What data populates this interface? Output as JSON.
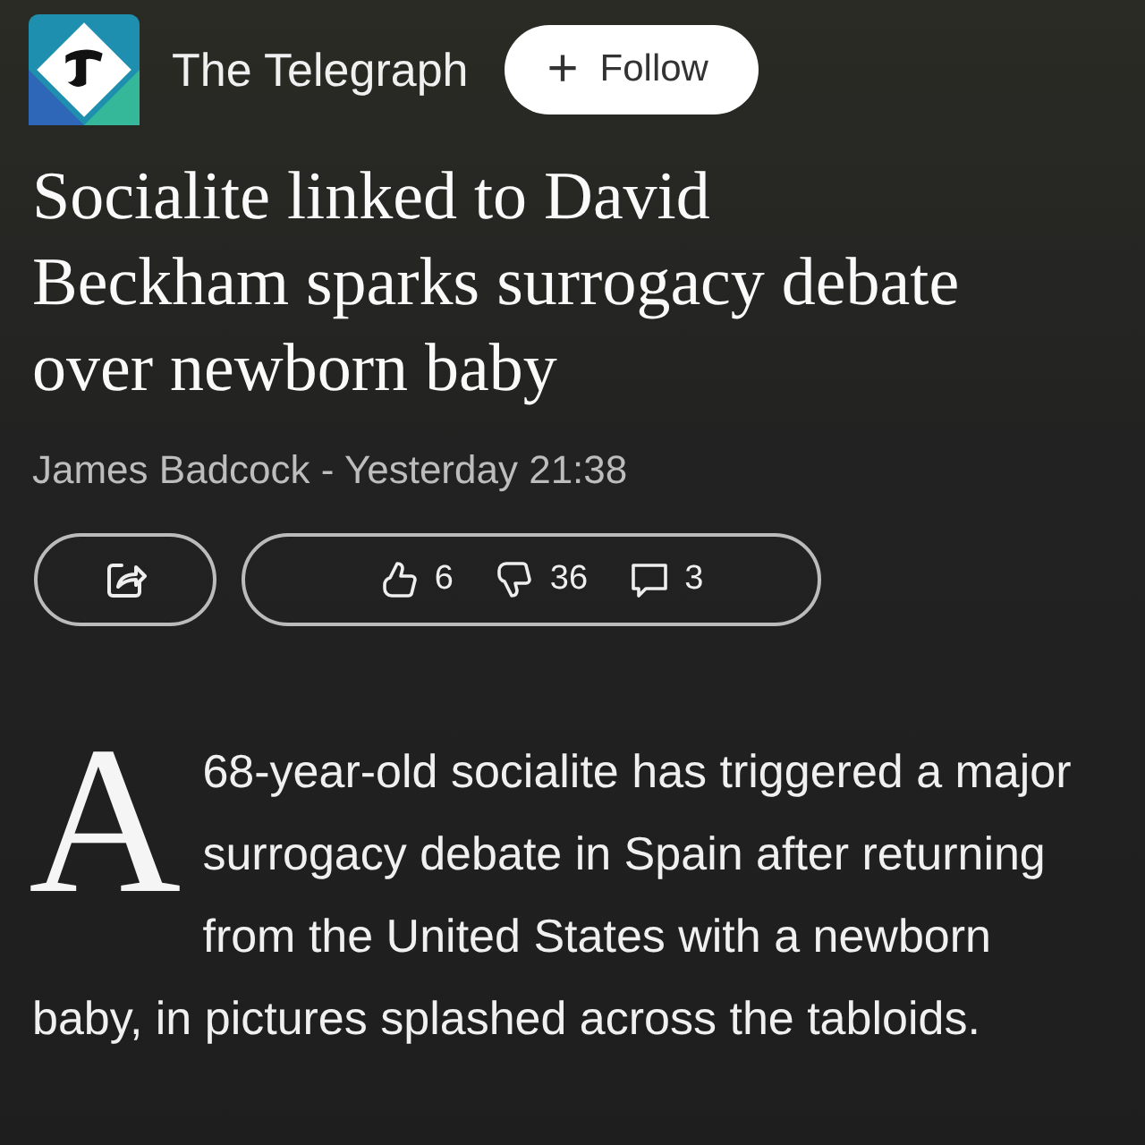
{
  "source": {
    "name": "The Telegraph",
    "follow_label": "Follow",
    "follow_icon": "+"
  },
  "article": {
    "title": "Socialite linked to David Beckham sparks surrogacy debate over newborn baby",
    "byline": "James Badcock - Yesterday 21:38",
    "reactions": [
      {
        "kind": "like",
        "count": "6"
      },
      {
        "kind": "dislike",
        "count": "36"
      },
      {
        "kind": "comment",
        "count": "3"
      }
    ],
    "drop_cap": "A",
    "body": "68-year-old socialite has triggered a major surrogacy debate in Spain after returning from the United States with a newborn baby, in pictures splashed across the tabloids."
  }
}
